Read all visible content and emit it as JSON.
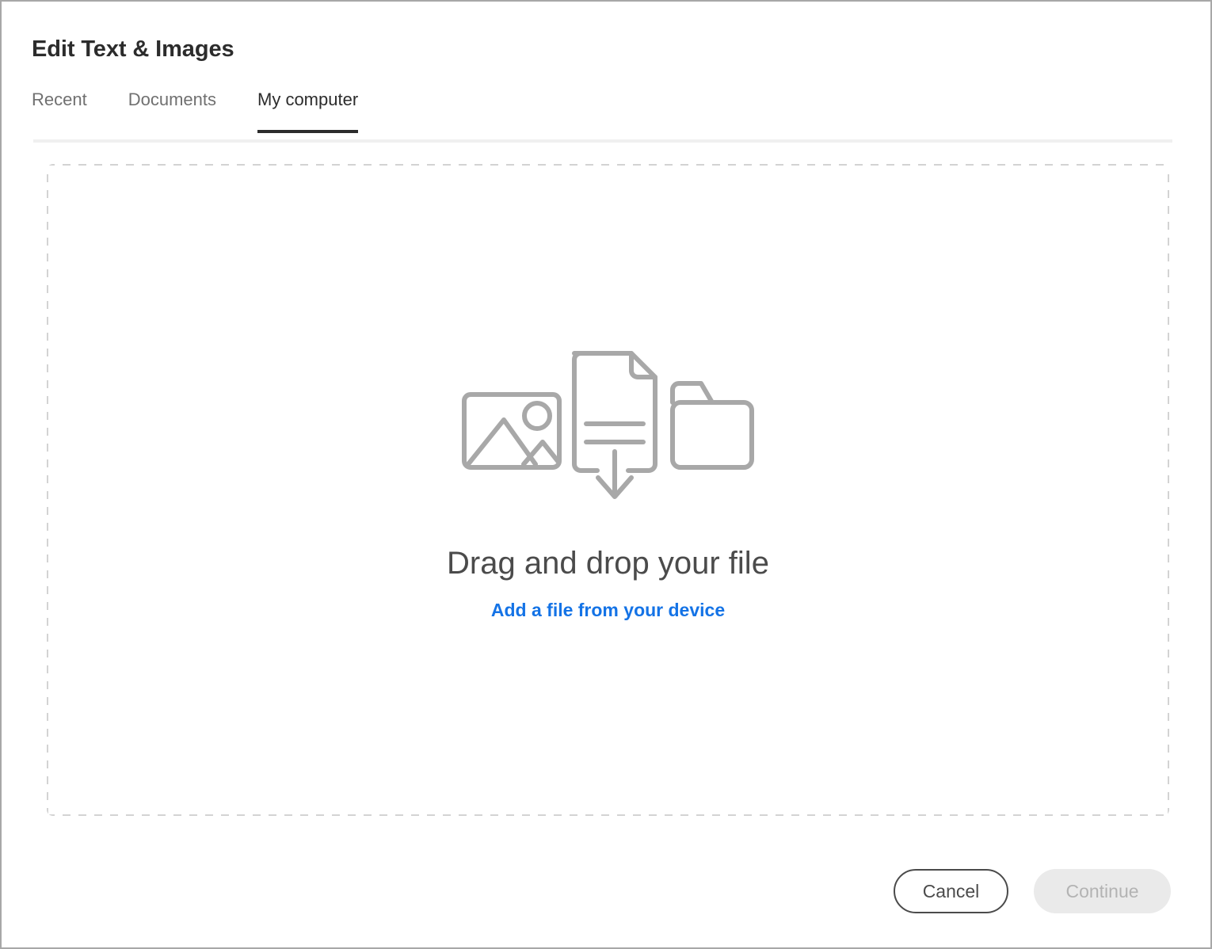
{
  "window": {
    "title": "Edit Text & Images"
  },
  "tabs": [
    {
      "label": "Recent",
      "active": false
    },
    {
      "label": "Documents",
      "active": false
    },
    {
      "label": "My computer",
      "active": true
    }
  ],
  "dropzone": {
    "headline": "Drag and drop your file",
    "link_label": "Add a file from your device",
    "icons": [
      "image-icon",
      "document-download-icon",
      "folder-icon"
    ],
    "border_style": "dashed",
    "border_color": "#d3d3d3"
  },
  "footer": {
    "cancel_label": "Cancel",
    "continue_label": "Continue",
    "continue_disabled": true
  },
  "colors": {
    "accent_link": "#1473e6",
    "title_text": "#2c2c2c",
    "tab_inactive": "#707070",
    "icon_gray": "#a8a8a8",
    "disabled_text": "#b3b3b3",
    "disabled_fill": "#eaeaea"
  }
}
